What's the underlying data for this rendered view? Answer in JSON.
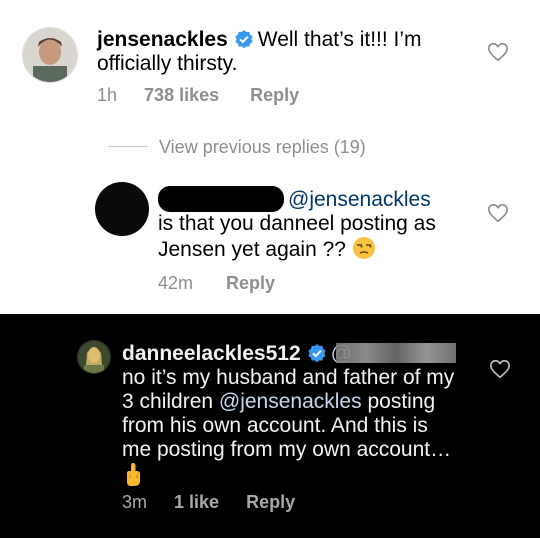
{
  "comment1": {
    "username": "jensenackles",
    "text_line1": "Well that’s it!!! I’m",
    "text_line2": "officially thirsty.",
    "time": "1h",
    "likes": "738 likes",
    "reply": "Reply"
  },
  "thread": {
    "view_previous": "View previous replies (19)"
  },
  "reply1": {
    "mention": "@jensenackles",
    "text_line1": "is that you danneel posting as",
    "text_line2": "Jensen yet again ??",
    "emoji": "unamused-face",
    "time": "42m",
    "reply": "Reply"
  },
  "reply2": {
    "username": "danneelackles512",
    "mention_prefix": "@",
    "text_line1": "no it’s my husband and father of my",
    "text_line2_a": "3 children ",
    "text_line2_mention": "@jensenackles",
    "text_line2_b": " posting",
    "text_line3": "from his own account. And this is",
    "text_line4": "me posting from my own account…",
    "emoji": "middle-finger",
    "time": "3m",
    "likes": "1 like",
    "reply": "Reply"
  },
  "colors": {
    "verified_blue": "#3897f0",
    "meta_gray": "#8e8e8e",
    "mention_light": "#00376b",
    "mention_dark": "#c7d7ea"
  }
}
